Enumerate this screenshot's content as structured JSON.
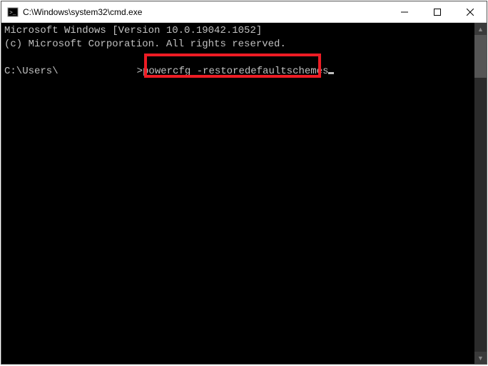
{
  "titlebar": {
    "title": "C:\\Windows\\system32\\cmd.exe"
  },
  "terminal": {
    "line1": "Microsoft Windows [Version 10.0.19042.1052]",
    "line2": "(c) Microsoft Corporation. All rights reserved.",
    "prompt_prefix": "C:\\Users\\",
    "prompt_suffix": ">",
    "command": "powercfg -restoredefaultschemes"
  }
}
